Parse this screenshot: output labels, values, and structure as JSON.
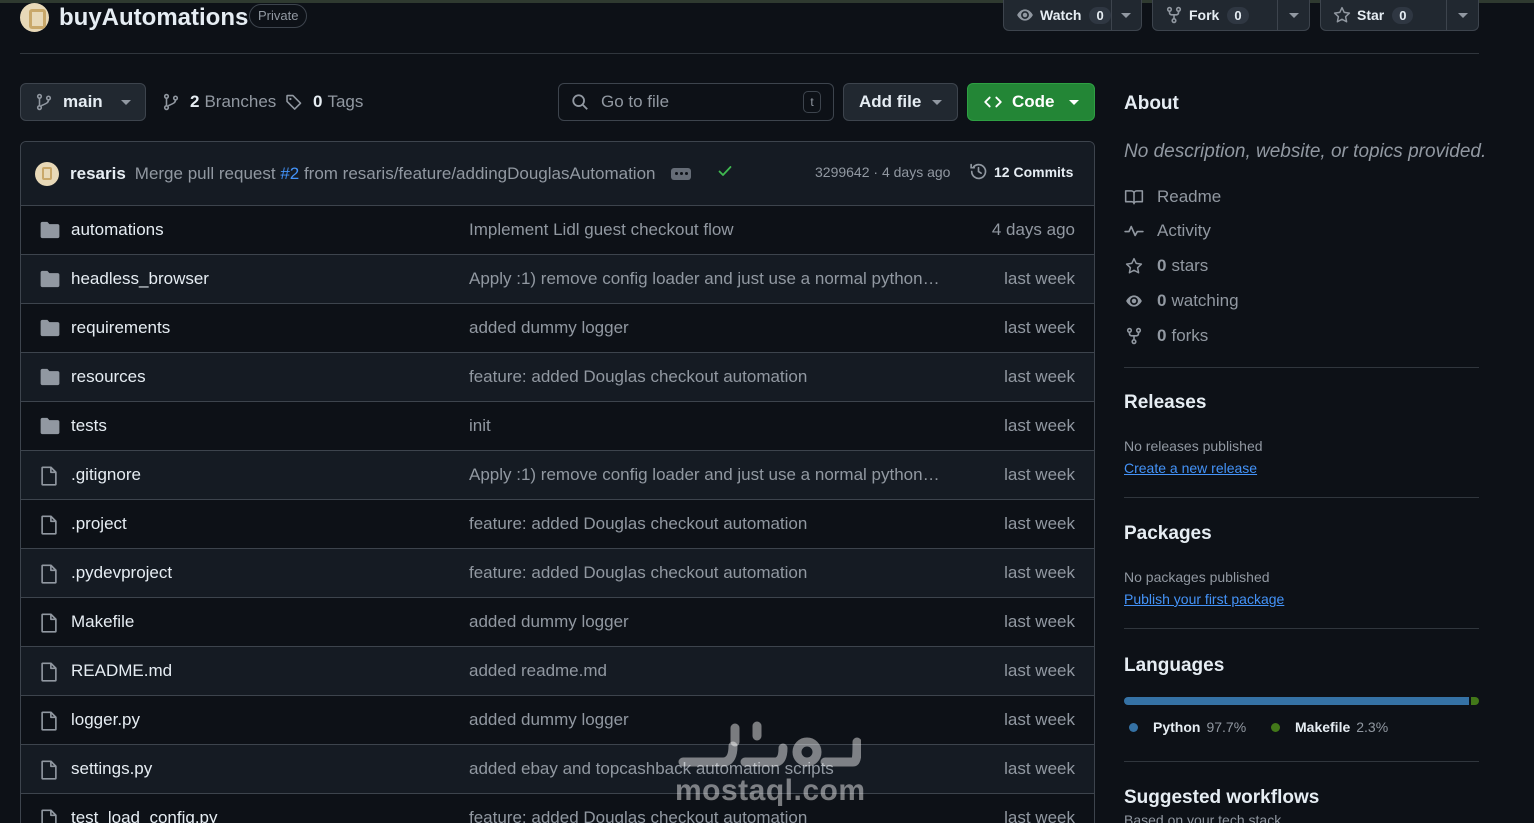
{
  "repo": {
    "name": "buyAutomations",
    "visibility": "Private"
  },
  "header_actions": {
    "watch": {
      "label": "Watch",
      "count": "0"
    },
    "fork": {
      "label": "Fork",
      "count": "0"
    },
    "star": {
      "label": "Star",
      "count": "0"
    }
  },
  "toolbar": {
    "branch": "main",
    "branches_count": "2",
    "branches_label": "Branches",
    "tags_count": "0",
    "tags_label": "Tags",
    "search_placeholder": "Go to file",
    "search_shortcut": "t",
    "add_file_label": "Add file",
    "code_label": "Code"
  },
  "latest_commit": {
    "author": "resaris",
    "message_prefix": "Merge pull request ",
    "pr_ref": "#2",
    "message_suffix": " from resaris/feature/addingDouglasAutomation",
    "sha_time": "3299642 · 4 days ago",
    "commits_label": "12 Commits"
  },
  "files": [
    {
      "type": "folder",
      "name": "automations",
      "message": "Implement Lidl guest checkout flow",
      "date": "4 days ago"
    },
    {
      "type": "folder",
      "name": "headless_browser",
      "message": "Apply :1) remove config loader and just use a normal python…",
      "date": "last week"
    },
    {
      "type": "folder",
      "name": "requirements",
      "message": "added dummy logger",
      "date": "last week"
    },
    {
      "type": "folder",
      "name": "resources",
      "message": "feature: added Douglas checkout automation",
      "date": "last week"
    },
    {
      "type": "folder",
      "name": "tests",
      "message": "init",
      "date": "last week"
    },
    {
      "type": "file",
      "name": ".gitignore",
      "message": "Apply :1) remove config loader and just use a normal python…",
      "date": "last week"
    },
    {
      "type": "file",
      "name": ".project",
      "message": "feature: added Douglas checkout automation",
      "date": "last week"
    },
    {
      "type": "file",
      "name": ".pydevproject",
      "message": "feature: added Douglas checkout automation",
      "date": "last week"
    },
    {
      "type": "file",
      "name": "Makefile",
      "message": "added dummy logger",
      "date": "last week"
    },
    {
      "type": "file",
      "name": "README.md",
      "message": "added readme.md",
      "date": "last week"
    },
    {
      "type": "file",
      "name": "logger.py",
      "message": "added dummy logger",
      "date": "last week"
    },
    {
      "type": "file",
      "name": "settings.py",
      "message": "added ebay and topcashback automation scripts",
      "date": "last week"
    },
    {
      "type": "file",
      "name": "test_load_config.py",
      "message": "feature: added Douglas checkout automation",
      "date": "last week"
    }
  ],
  "about": {
    "title": "About",
    "description": "No description, website, or topics provided.",
    "readme": "Readme",
    "activity": "Activity",
    "stars_count": "0",
    "stars_label": "stars",
    "watching_count": "0",
    "watching_label": "watching",
    "forks_count": "0",
    "forks_label": "forks"
  },
  "releases": {
    "title": "Releases",
    "empty": "No releases published",
    "link": "Create a new release"
  },
  "packages": {
    "title": "Packages",
    "empty": "No packages published",
    "link": "Publish your first package"
  },
  "languages": {
    "title": "Languages",
    "items": [
      {
        "name": "Python",
        "percent_label": "97.7%",
        "percent": 97.7,
        "color": "#3572A5"
      },
      {
        "name": "Makefile",
        "percent_label": "2.3%",
        "percent": 2.3,
        "color": "#427819"
      }
    ]
  },
  "suggested": {
    "title": "Suggested workflows",
    "subtitle": "Based on your tech stack"
  },
  "watermark": {
    "text": "mostaql.com"
  },
  "colors": {
    "background": "#0d1117",
    "accent_green": "#238636",
    "link_blue": "#4493f8",
    "muted": "#9198a1"
  }
}
